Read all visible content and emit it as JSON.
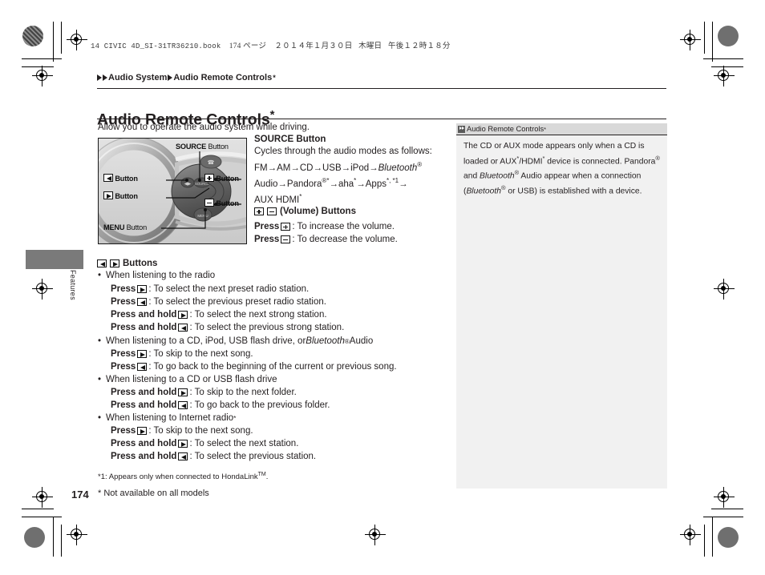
{
  "book_header": {
    "filename": "14 CIVIC 4D_SI-31TR36210.book",
    "page_marker": "174 ページ",
    "date": "２０１４年１月３０日",
    "weekday": "木曜日",
    "time": "午後１２時１８分"
  },
  "breadcrumb": {
    "level1": "Audio System",
    "level2": "Audio Remote Controls",
    "asterisk": "*"
  },
  "title": {
    "text": "Audio Remote Controls",
    "asterisk": "*"
  },
  "intro": "Allow you to operate the audio system while driving.",
  "figure": {
    "caption_source": "SOURCE",
    "caption_source_suffix": " Button",
    "label_left": "Button",
    "label_right": "Button",
    "label_plus": "Button",
    "label_minus": "Button",
    "label_menu": "MENU",
    "label_menu_suffix": " Button"
  },
  "source_section": {
    "heading": "SOURCE Button",
    "line1": "Cycles through the audio modes as follows:",
    "chain_line1_a": "FM→AM→CD→USB→iPod→",
    "chain_line1_b": "Bluetooth",
    "chain_line1_c": "®",
    "chain_line2_a": "Audio→Pandora",
    "chain_line2_b": "®",
    "chain_line2_c": "*",
    "chain_line2_d": "→aha",
    "chain_line2_e": "*",
    "chain_line2_f": "→Apps",
    "chain_line2_g": "*, *1",
    "chain_line2_h": "→",
    "chain_line3": "AUX HDMI",
    "chain_line3_sup": "*"
  },
  "volume_section": {
    "heading": "(Volume) Buttons",
    "rows": [
      {
        "press": "Press",
        "glyph": "plus",
        "text": ": To increase the volume."
      },
      {
        "press": "Press",
        "glyph": "minus",
        "text": ": To decrease the volume."
      }
    ]
  },
  "lr_section": {
    "heading": "Buttons",
    "groups": [
      {
        "bullet": "When listening to the radio",
        "rows": [
          {
            "press": "Press",
            "glyph": "right",
            "text": ": To select the next preset radio station."
          },
          {
            "press": "Press",
            "glyph": "left",
            "text": ": To select the previous preset radio station."
          },
          {
            "press": "Press and hold",
            "glyph": "right",
            "text": ": To select the next strong station."
          },
          {
            "press": "Press and hold",
            "glyph": "left",
            "text": ": To select the previous strong station."
          }
        ]
      },
      {
        "bullet_a": "When listening to a CD, iPod, USB flash drive, or ",
        "bullet_italic": "Bluetooth",
        "bullet_sup": "®",
        "bullet_b": " Audio",
        "rows": [
          {
            "press": "Press",
            "glyph": "right",
            "text": ": To skip to the next song."
          },
          {
            "press": "Press",
            "glyph": "left",
            "text": ": To go back to the beginning of the current or previous song."
          }
        ]
      },
      {
        "bullet": "When listening to a CD or USB flash drive",
        "rows": [
          {
            "press": "Press and hold",
            "glyph": "right",
            "text": ": To skip to the next folder."
          },
          {
            "press": "Press and hold",
            "glyph": "left",
            "text": ": To go back to the previous folder."
          }
        ]
      },
      {
        "bullet": "When listening to Internet radio",
        "bullet_sup": "*",
        "rows": [
          {
            "press": "Press",
            "glyph": "right",
            "text": ": To skip to the next song."
          },
          {
            "press": "Press and hold",
            "glyph": "right",
            "text": ": To select the next station."
          },
          {
            "press": "Press and hold",
            "glyph": "left",
            "text": ": To select the previous station."
          }
        ]
      }
    ]
  },
  "note_panel": {
    "tab_title": "Audio Remote Controls",
    "tab_asterisk": "*",
    "body_part1": "The CD or AUX mode appears only when a CD is loaded or AUX",
    "body_sup1": "*",
    "body_part2": "/HDMI",
    "body_sup2": "*",
    "body_part3": " device is connected. Pandora",
    "body_sup3": "®",
    "body_part4": " and ",
    "body_italic1": "Bluetooth",
    "body_sup4": "®",
    "body_part5": " Audio appear when a connection (",
    "body_italic2": "Bluetooth",
    "body_sup5": "®",
    "body_part6": " or USB) is established with a device."
  },
  "footnotes": {
    "note1_a": "*1: Appears only when connected to HondaLink",
    "note1_sup": "TM",
    "note1_b": ".",
    "note2": "* Not available on all models"
  },
  "folio": "174",
  "thumb_tab_label": "Features",
  "colors": {
    "ink": "#231f20",
    "figure_bg": "#d9d9d9",
    "note_bg": "#f1f1f1",
    "tab_gray": "#7a7a7a"
  }
}
